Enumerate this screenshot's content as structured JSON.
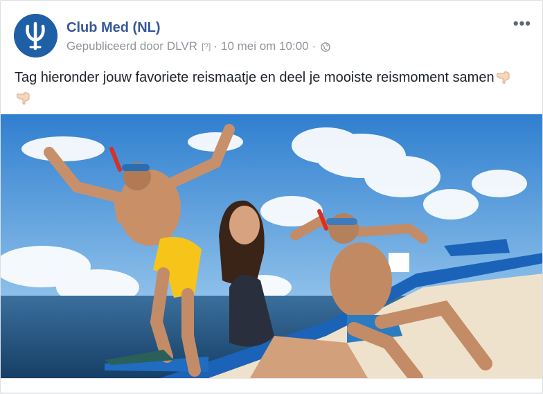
{
  "page": {
    "name": "Club Med (NL)"
  },
  "post": {
    "published_prefix": "Gepubliceerd door",
    "publisher": "DLVR",
    "help_mark": "[?]",
    "separator": "·",
    "timestamp": "10 mei om 10:00",
    "privacy_icon": "globe-icon",
    "more_label": "•••",
    "caption": "Tag hieronder jouw favoriete reismaatje en deel je mooiste reismoment samen",
    "caption_emoji": "hand-pointing-down-icon"
  },
  "colors": {
    "link_blue": "#365899",
    "meta_gray": "#90949c",
    "avatar_blue": "#1f5fa6",
    "sky": "#3f8fd6",
    "sea": "#22507e",
    "boat_blue": "#1b63b8"
  }
}
